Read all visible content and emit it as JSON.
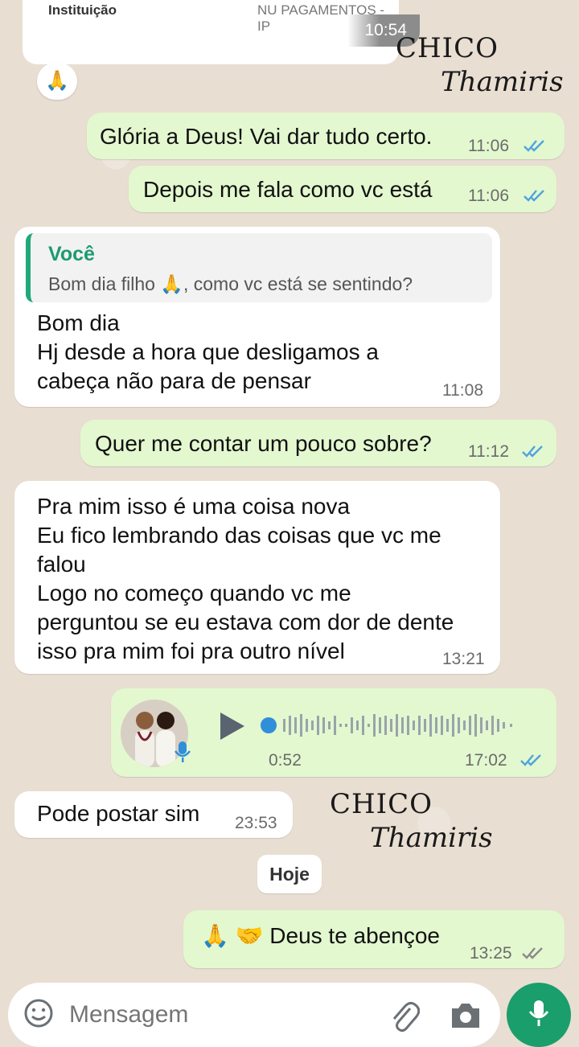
{
  "top_card": {
    "label": "Instituição",
    "value": "NU PAGAMENTOS - IP",
    "time": "10:54"
  },
  "reaction": "🙏",
  "watermark": {
    "line1": "CHICO",
    "line2": "Thamiris"
  },
  "messages": [
    {
      "dir": "out",
      "text": "Glória a Deus! Vai dar tudo certo.",
      "time": "11:06",
      "read": true
    },
    {
      "dir": "out",
      "text": "Depois me fala como vc está",
      "time": "11:06",
      "read": true
    },
    {
      "dir": "in",
      "quote_author": "Você",
      "quote_text": "Bom dia filho 🙏, como vc está se sentindo?",
      "text": "Bom dia\nHj desde a hora que desligamos a\ncabeça não para de pensar",
      "time": "11:08"
    },
    {
      "dir": "out",
      "text": "Quer me contar um pouco sobre?",
      "time": "11:12",
      "read": true
    },
    {
      "dir": "in",
      "text": "Pra mim isso é uma coisa nova\nEu fico lembrando das coisas que vc me\nfalou\nLogo no começo quando vc me\nperguntou se eu estava com dor de dente\nisso pra mim foi pra outro nível",
      "time": "13:21"
    },
    {
      "dir": "out",
      "type": "voice",
      "duration": "0:52",
      "time": "17:02",
      "read": true
    },
    {
      "dir": "in",
      "text": "Pode postar sim",
      "time": "23:53"
    },
    {
      "dir": "out",
      "text": "🙏 🤝 Deus te abençoe",
      "time": "13:25",
      "read": false
    }
  ],
  "date_divider": "Hoje",
  "composer": {
    "placeholder": "Mensagem"
  },
  "colors": {
    "outgoing": "#e3f8cf",
    "incoming": "#ffffff",
    "accent": "#1a9e6b",
    "read_ticks": "#4fa3e0"
  }
}
